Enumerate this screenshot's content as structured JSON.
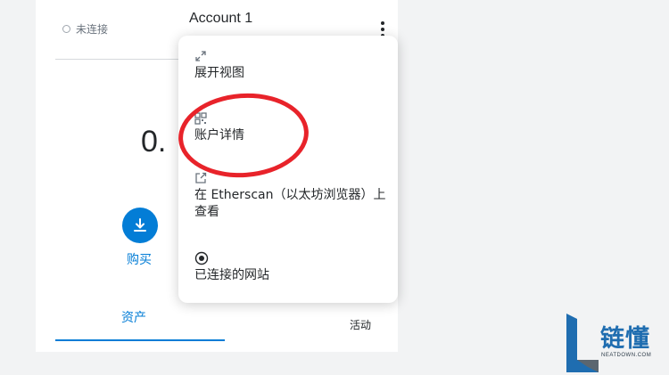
{
  "header": {
    "connection_status": "未连接",
    "account_name": "Account 1"
  },
  "balance": {
    "display": "0."
  },
  "actions": {
    "buy_label": "购买"
  },
  "tabs": {
    "assets": "资产",
    "activity": "活动"
  },
  "menu": {
    "items": [
      {
        "icon": "expand-icon",
        "label": "展开视图"
      },
      {
        "icon": "qr-code-icon",
        "label": "账户详情"
      },
      {
        "icon": "external-link-icon",
        "label": "在 Etherscan（以太坊浏览器）上查看"
      },
      {
        "icon": "connected-sites-icon",
        "label": "已连接的网站"
      }
    ]
  },
  "watermark": {
    "brand": "链懂",
    "domain": "NEATDOWN.COM"
  },
  "colors": {
    "accent": "#037dd6",
    "highlight": "#e8232a",
    "text": "#24272a"
  }
}
